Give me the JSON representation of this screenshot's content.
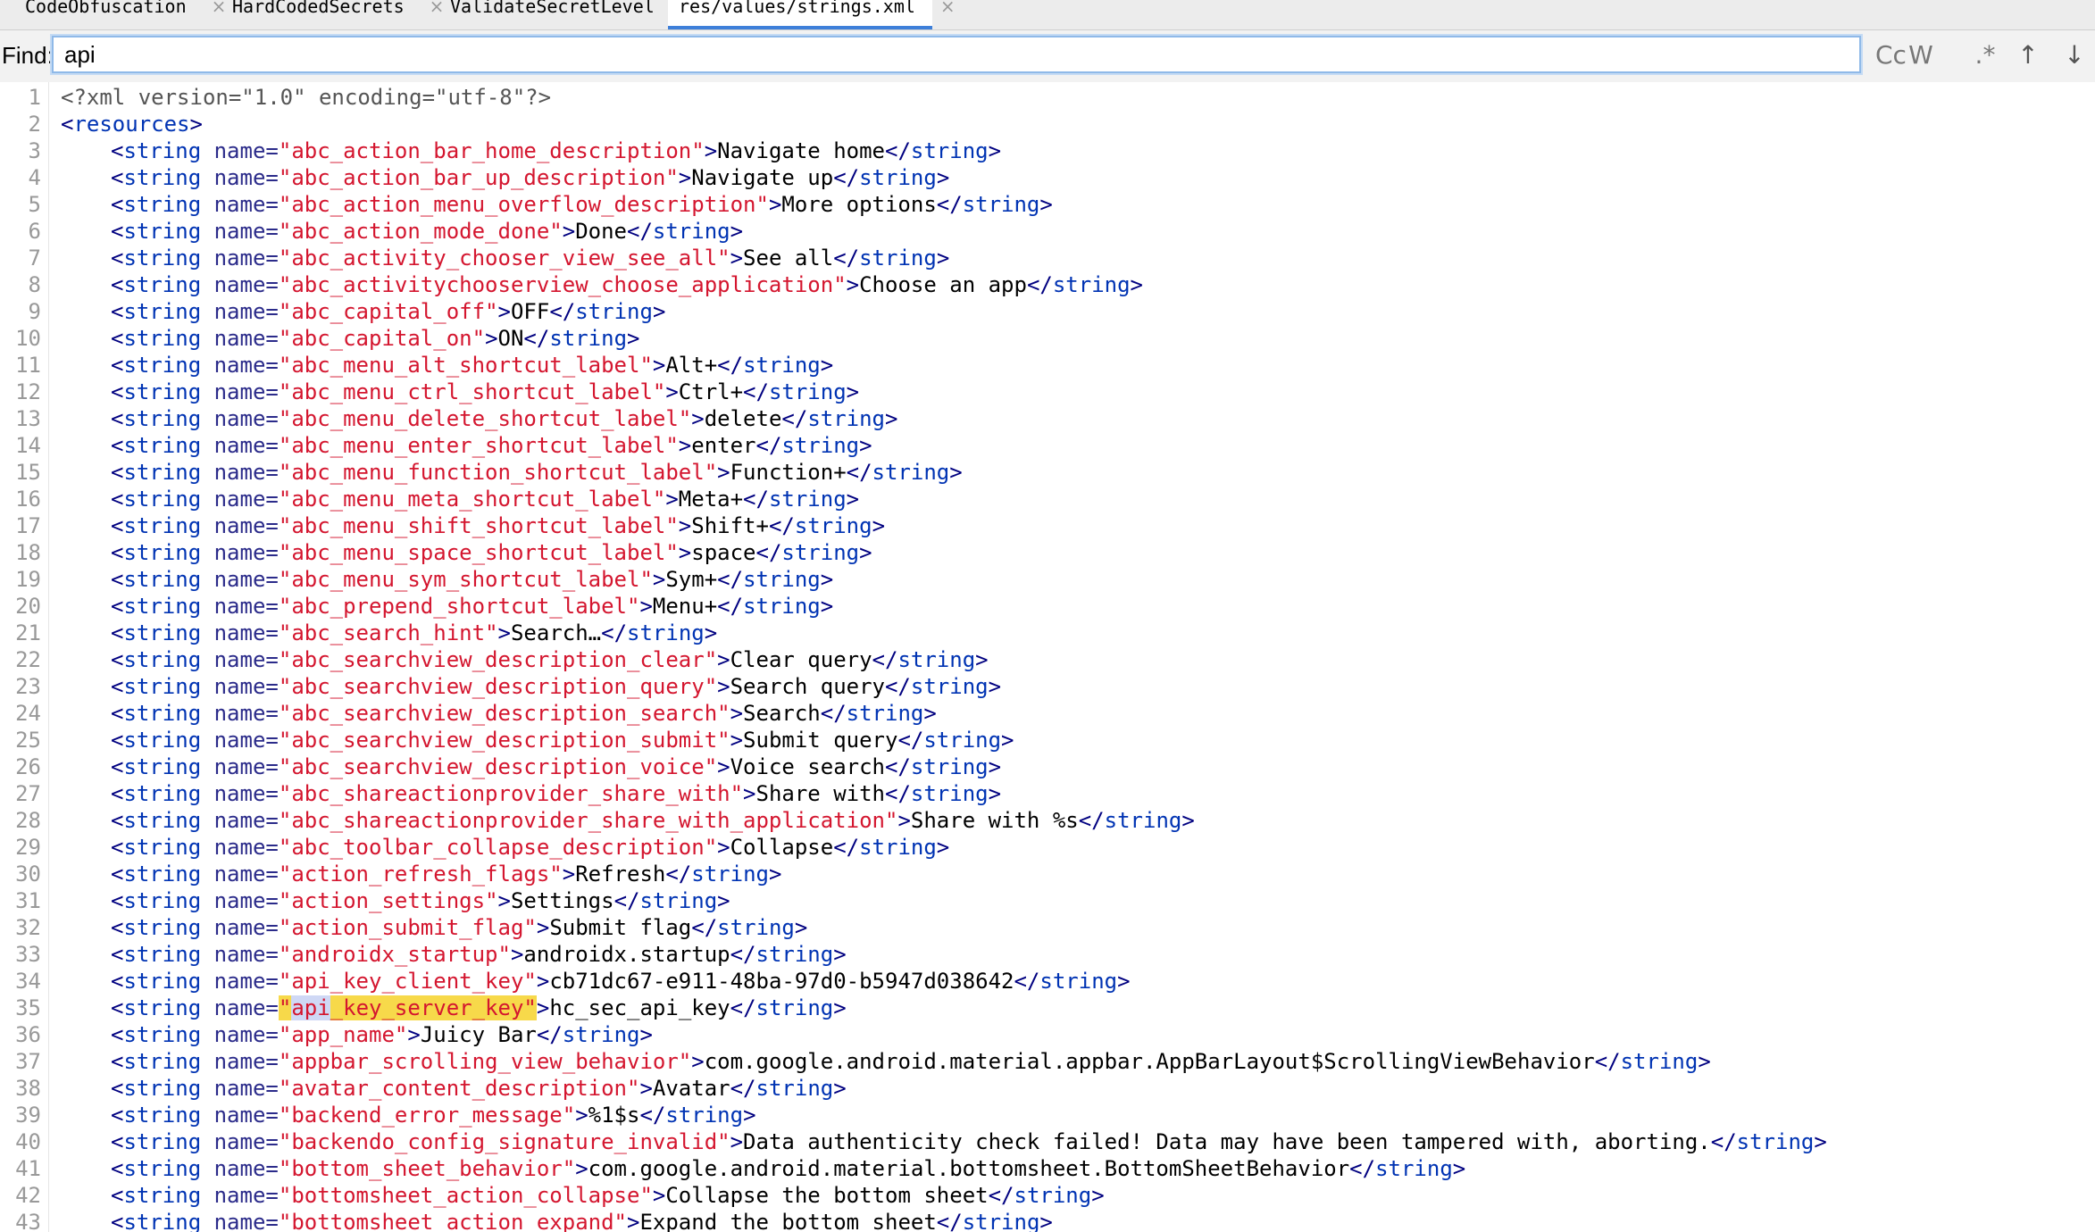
{
  "tabs": [
    {
      "label": "CodeObfuscation",
      "icon": "class-icon",
      "active": false
    },
    {
      "label": "HardCodedSecrets",
      "icon": "class-icon",
      "active": false
    },
    {
      "label": "ValidateSecretLevel",
      "icon": "test-icon",
      "active": false
    },
    {
      "label": "res/values/strings.xml",
      "icon": "xml-file-icon",
      "active": true
    }
  ],
  "find": {
    "label": "Find:",
    "query": "api",
    "options": {
      "match_case": "Cc",
      "words": "W",
      "regex": ".*",
      "prev": "↑",
      "next": "↓"
    }
  },
  "editor": {
    "xml_decl": "<?xml version=\"1.0\" encoding=\"utf-8\"?>",
    "root_tag": "resources",
    "highlighted_line": 35,
    "highlight_term": "api",
    "strings": [
      {
        "name": "abc_action_bar_home_description",
        "value": "Navigate home"
      },
      {
        "name": "abc_action_bar_up_description",
        "value": "Navigate up"
      },
      {
        "name": "abc_action_menu_overflow_description",
        "value": "More options"
      },
      {
        "name": "abc_action_mode_done",
        "value": "Done"
      },
      {
        "name": "abc_activity_chooser_view_see_all",
        "value": "See all"
      },
      {
        "name": "abc_activitychooserview_choose_application",
        "value": "Choose an app"
      },
      {
        "name": "abc_capital_off",
        "value": "OFF"
      },
      {
        "name": "abc_capital_on",
        "value": "ON"
      },
      {
        "name": "abc_menu_alt_shortcut_label",
        "value": "Alt+"
      },
      {
        "name": "abc_menu_ctrl_shortcut_label",
        "value": "Ctrl+"
      },
      {
        "name": "abc_menu_delete_shortcut_label",
        "value": "delete"
      },
      {
        "name": "abc_menu_enter_shortcut_label",
        "value": "enter"
      },
      {
        "name": "abc_menu_function_shortcut_label",
        "value": "Function+"
      },
      {
        "name": "abc_menu_meta_shortcut_label",
        "value": "Meta+"
      },
      {
        "name": "abc_menu_shift_shortcut_label",
        "value": "Shift+"
      },
      {
        "name": "abc_menu_space_shortcut_label",
        "value": "space"
      },
      {
        "name": "abc_menu_sym_shortcut_label",
        "value": "Sym+"
      },
      {
        "name": "abc_prepend_shortcut_label",
        "value": "Menu+"
      },
      {
        "name": "abc_search_hint",
        "value": "Search…"
      },
      {
        "name": "abc_searchview_description_clear",
        "value": "Clear query"
      },
      {
        "name": "abc_searchview_description_query",
        "value": "Search query"
      },
      {
        "name": "abc_searchview_description_search",
        "value": "Search"
      },
      {
        "name": "abc_searchview_description_submit",
        "value": "Submit query"
      },
      {
        "name": "abc_searchview_description_voice",
        "value": "Voice search"
      },
      {
        "name": "abc_shareactionprovider_share_with",
        "value": "Share with"
      },
      {
        "name": "abc_shareactionprovider_share_with_application",
        "value": "Share with %s"
      },
      {
        "name": "abc_toolbar_collapse_description",
        "value": "Collapse"
      },
      {
        "name": "action_refresh_flags",
        "value": "Refresh"
      },
      {
        "name": "action_settings",
        "value": "Settings"
      },
      {
        "name": "action_submit_flag",
        "value": "Submit flag"
      },
      {
        "name": "androidx_startup",
        "value": "androidx.startup"
      },
      {
        "name": "api_key_client_key",
        "value": "cb71dc67-e911-48ba-97d0-b5947d038642"
      },
      {
        "name": "api_key_server_key",
        "value": "hc_sec_api_key"
      },
      {
        "name": "app_name",
        "value": "Juicy Bar"
      },
      {
        "name": "appbar_scrolling_view_behavior",
        "value": "com.google.android.material.appbar.AppBarLayout$ScrollingViewBehavior"
      },
      {
        "name": "avatar_content_description",
        "value": "Avatar"
      },
      {
        "name": "backend_error_message",
        "value": "%1$s"
      },
      {
        "name": "backendo_config_signature_invalid",
        "value": "Data authenticity check failed! Data may have been tampered with, aborting."
      },
      {
        "name": "bottom_sheet_behavior",
        "value": "com.google.android.material.bottomsheet.BottomSheetBehavior"
      },
      {
        "name": "bottomsheet_action_collapse",
        "value": "Collapse the bottom sheet"
      },
      {
        "name": "bottomsheet_action_expand",
        "value": "Expand the bottom sheet"
      }
    ]
  }
}
